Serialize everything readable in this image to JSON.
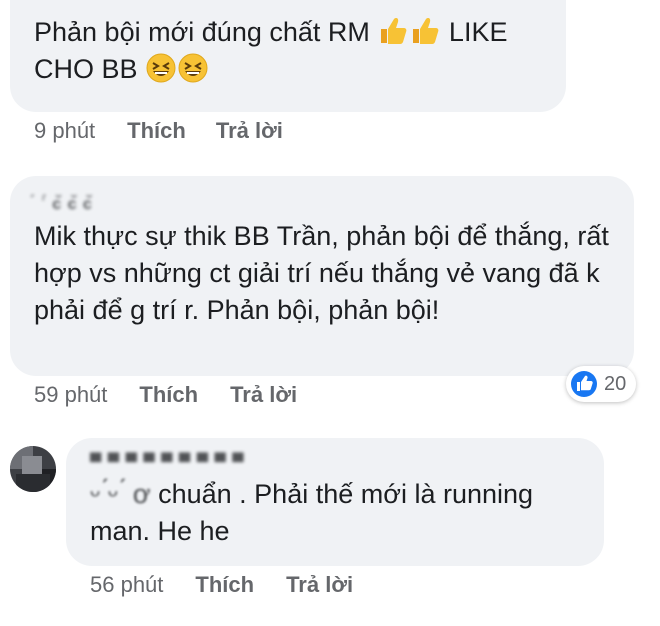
{
  "comments": [
    {
      "text_line1": "Phản bội mới đúng chất RM",
      "text_line1_tail": "LIKE",
      "text_line2": "CHO BB",
      "emoji_1": "thumbs-up-icon",
      "emoji_2": "grinning-squinting-face-icon",
      "time": "9 phút",
      "like_label": "Thích",
      "reply_label": "Trả lời"
    },
    {
      "author": "́ ˈ́ c̆ c̆ c̆",
      "text": "Mik thực sự thik BB Trần, phản bội để thắng, rất hợp vs những ct giải trí nếu thắng vẻ vang đã k phải để g trí r. Phản bội, phản bội!",
      "time": "59 phút",
      "like_label": "Thích",
      "reply_label": "Trả lời",
      "reaction_count": "20",
      "reaction_icon": "like-icon"
    },
    {
      "author": "▀ ▀ ▀  ▀ ▀ ▀  ▀ ▀ ▀",
      "text_prefix": "ᵕ ́ᵕ ́ ơ",
      "text": "chuẩn . Phải thế mới là running man. He he",
      "time": "56 phút",
      "like_label": "Thích",
      "reply_label": "Trả lời",
      "avatar_icon": "user-avatar-icon"
    }
  ],
  "colors": {
    "bubble_bg": "#f0f2f5",
    "meta_text": "#65676b",
    "like_blue": "#1877f2"
  }
}
